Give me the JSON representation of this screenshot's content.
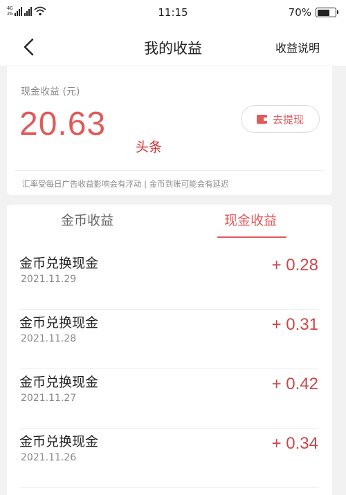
{
  "status_bar": {
    "network_top": "4G",
    "network_bottom": "2G",
    "time": "11:15",
    "battery": "70%",
    "battery_level": 0.7
  },
  "header": {
    "title": "我的收益",
    "right_link": "收益说明"
  },
  "summary": {
    "cash_label": "现金收益 (元)",
    "amount": "20.63",
    "withdraw_button": "去提现",
    "watermark": "头条",
    "note": "汇率受每日广告收益影响会有浮动 | 金币到账可能会有延迟"
  },
  "tabs": [
    {
      "label": "金币收益",
      "active": false
    },
    {
      "label": "现金收益",
      "active": true
    }
  ],
  "records": [
    {
      "title": "金币兑换现金",
      "date": "2021.11.29",
      "amount": "+ 0.28"
    },
    {
      "title": "金币兑换现金",
      "date": "2021.11.28",
      "amount": "+ 0.31"
    },
    {
      "title": "金币兑换现金",
      "date": "2021.11.27",
      "amount": "+ 0.42"
    },
    {
      "title": "金币兑换现金",
      "date": "2021.11.26",
      "amount": "+ 0.34"
    }
  ],
  "colors": {
    "accent": "#e05a5a",
    "amount": "#c84747",
    "background": "#f2f2f2"
  }
}
